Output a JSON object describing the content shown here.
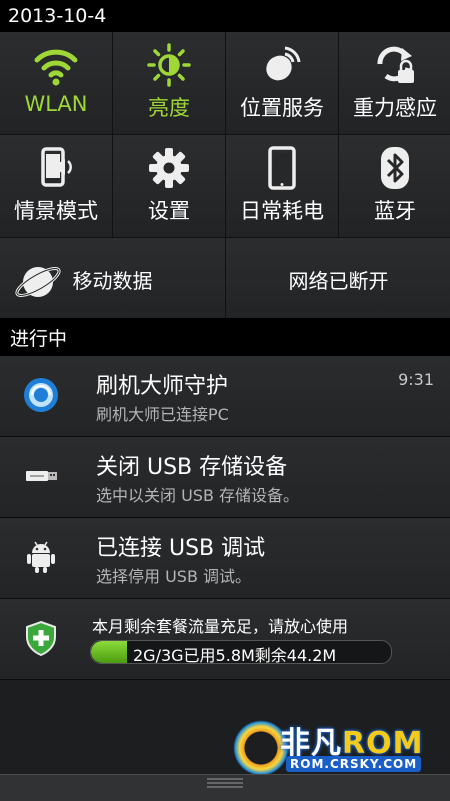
{
  "status_bar": {
    "date": "2013-10-4"
  },
  "quick_toggles": [
    {
      "label": "WLAN",
      "icon": "wifi-icon",
      "active": true
    },
    {
      "label": "亮度",
      "icon": "brightness-icon",
      "active": true
    },
    {
      "label": "位置服务",
      "icon": "location-icon",
      "active": false
    },
    {
      "label": "重力感应",
      "icon": "rotation-lock-icon",
      "active": false
    },
    {
      "label": "情景模式",
      "icon": "sound-profile-icon",
      "active": false
    },
    {
      "label": "设置",
      "icon": "gear-icon",
      "active": false
    },
    {
      "label": "日常耗电",
      "icon": "phone-icon",
      "active": false
    },
    {
      "label": "蓝牙",
      "icon": "bluetooth-icon",
      "active": false
    }
  ],
  "wide_toggles": [
    {
      "label": "移动数据",
      "icon": "planet-icon"
    },
    {
      "label": "网络已断开"
    }
  ],
  "section_header": "进行中",
  "notifications": [
    {
      "title": "刷机大师守护",
      "subtitle": "刷机大师已连接PC",
      "time": "9:31",
      "icon": "flash-master-icon"
    },
    {
      "title": "关闭 USB 存储设备",
      "subtitle": "选中以关闭 USB 存储设备。",
      "icon": "usb-icon"
    },
    {
      "title": "已连接 USB 调试",
      "subtitle": "选择停用 USB 调试。",
      "icon": "android-icon"
    }
  ],
  "data_usage": {
    "title": "本月剩余套餐流量充足，请放心使用",
    "bar_text": "2G/3G已用5.8M剩余44.2M",
    "used_fraction": 0.12,
    "icon": "shield-plus-icon"
  },
  "watermark": {
    "brand": "非凡",
    "brand_suffix": "ROM",
    "site": "ROM.CRSKY.COM"
  },
  "colors": {
    "active": "#9fd836",
    "background": "#1c1e1f",
    "bar_fill": "#6cc02a"
  }
}
